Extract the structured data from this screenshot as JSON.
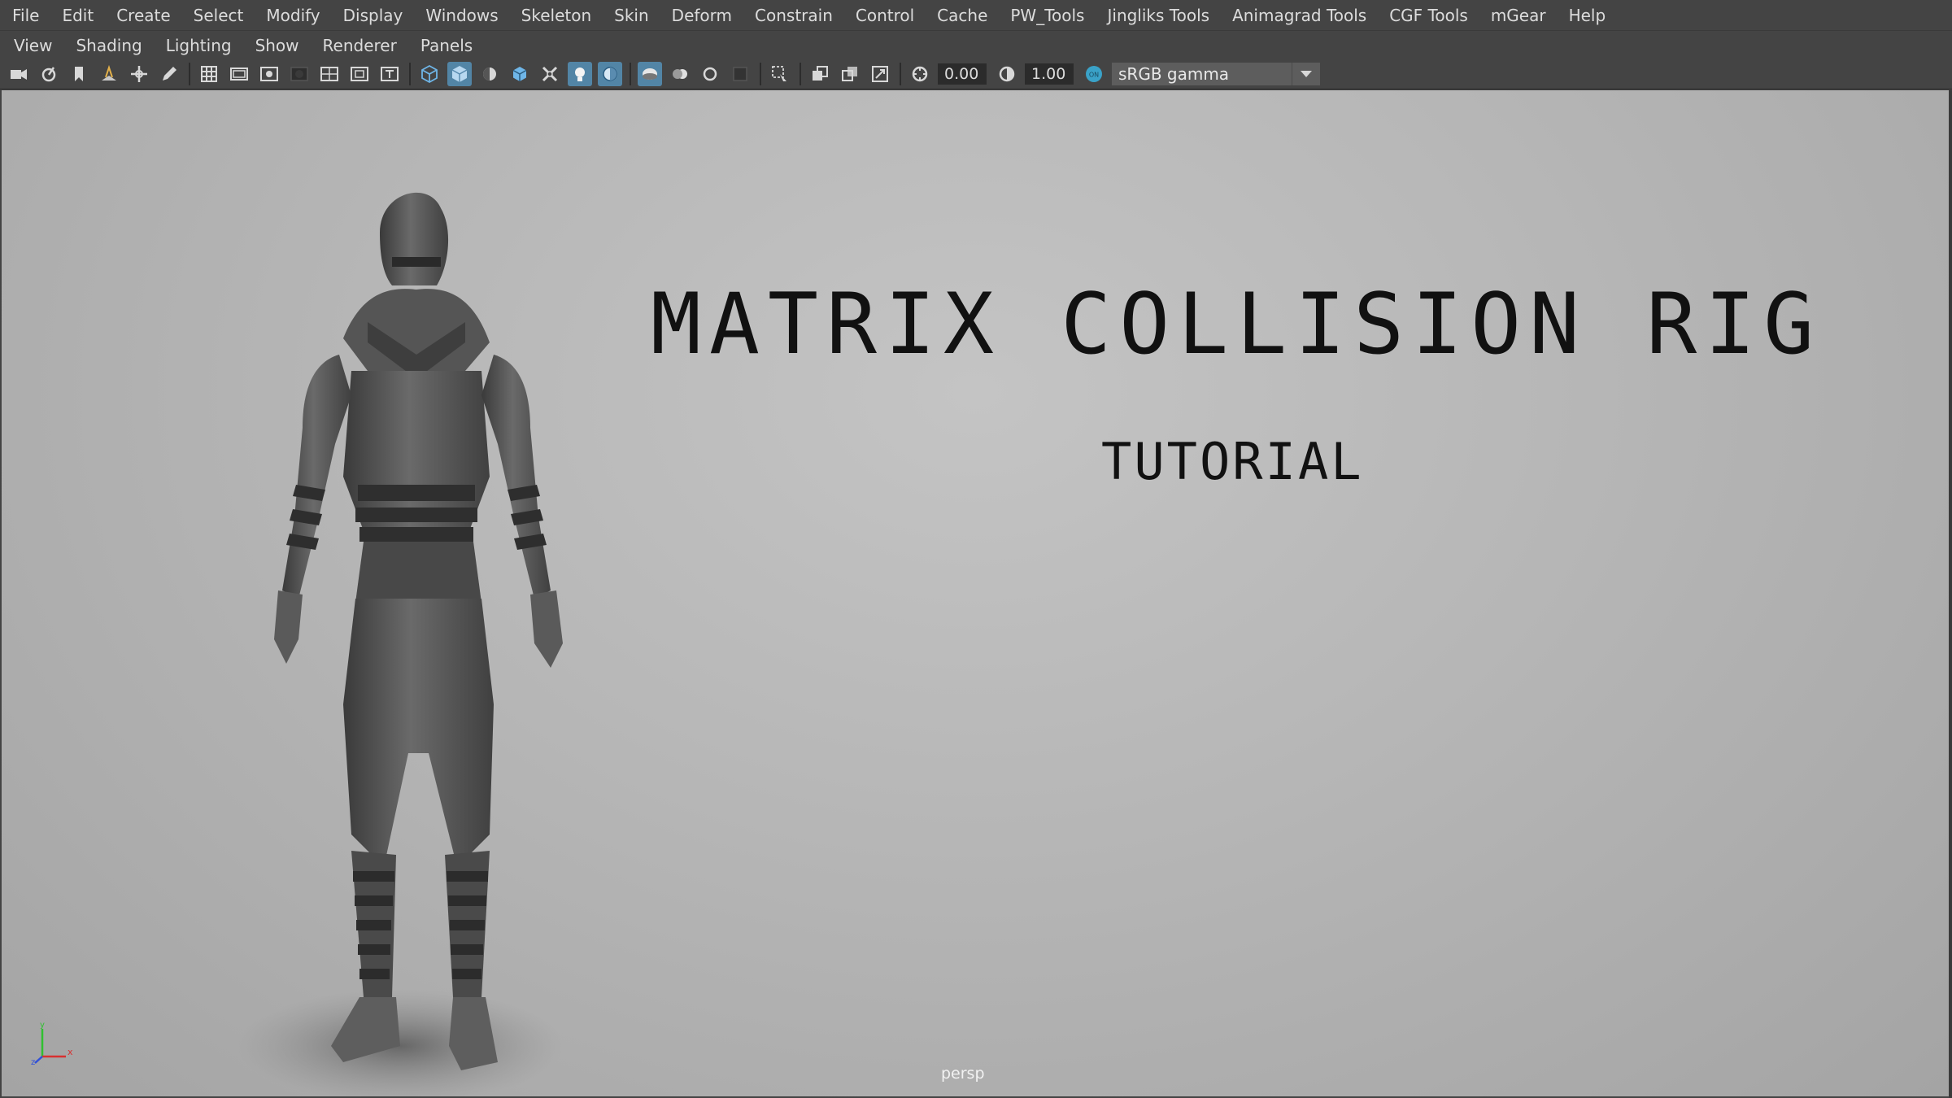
{
  "main_menu": {
    "items": [
      "File",
      "Edit",
      "Create",
      "Select",
      "Modify",
      "Display",
      "Windows",
      "Skeleton",
      "Skin",
      "Deform",
      "Constrain",
      "Control",
      "Cache",
      "PW_Tools",
      "Jingliks Tools",
      "Animagrad Tools",
      "CGF Tools",
      "mGear",
      "Help"
    ]
  },
  "panel_menu": {
    "items": [
      "View",
      "Shading",
      "Lighting",
      "Show",
      "Renderer",
      "Panels"
    ]
  },
  "toolbar": {
    "exposure_value": "0.00",
    "gamma_value": "1.00",
    "colorspace_label": "sRGB gamma",
    "colorspace_toggle": "ON"
  },
  "viewport": {
    "title": "MATRIX COLLISION RIG",
    "subtitle": "TUTORIAL",
    "camera_name": "persp",
    "axis_labels": {
      "x": "x",
      "y": "y",
      "z": "z"
    }
  },
  "colors": {
    "ui_background": "#444444",
    "active_button": "#5285a6",
    "viewport_gradient_top": "#c4c4c4",
    "viewport_gradient_bottom": "#a4a4a4",
    "axis_x": "#d83030",
    "axis_y": "#30c030",
    "axis_z": "#3050d8"
  },
  "icons": [
    "camera-icon",
    "camera-attributes-icon",
    "bookmark-icon",
    "image-plane-icon",
    "2d-pan-zoom-icon",
    "grease-pencil-icon",
    "grid-icon",
    "film-gate-icon",
    "resolution-gate-icon",
    "gate-mask-icon",
    "field-chart-icon",
    "safe-action-icon",
    "safe-title-icon",
    "wireframe-icon",
    "smooth-shade-icon",
    "default-material-icon",
    "wireframe-on-shaded-icon",
    "xray-icon",
    "use-all-lights-icon",
    "shadows-icon",
    "screen-space-ao-icon",
    "motion-blur-icon",
    "anti-aliasing-icon",
    "depth-of-field-icon",
    "isolate-select-icon",
    "xray-joints-icon",
    "xray-active-icon",
    "backface-culling-icon",
    "exposure-icon",
    "gamma-icon",
    "color-management-icon",
    "dropdown-arrow-icon"
  ]
}
